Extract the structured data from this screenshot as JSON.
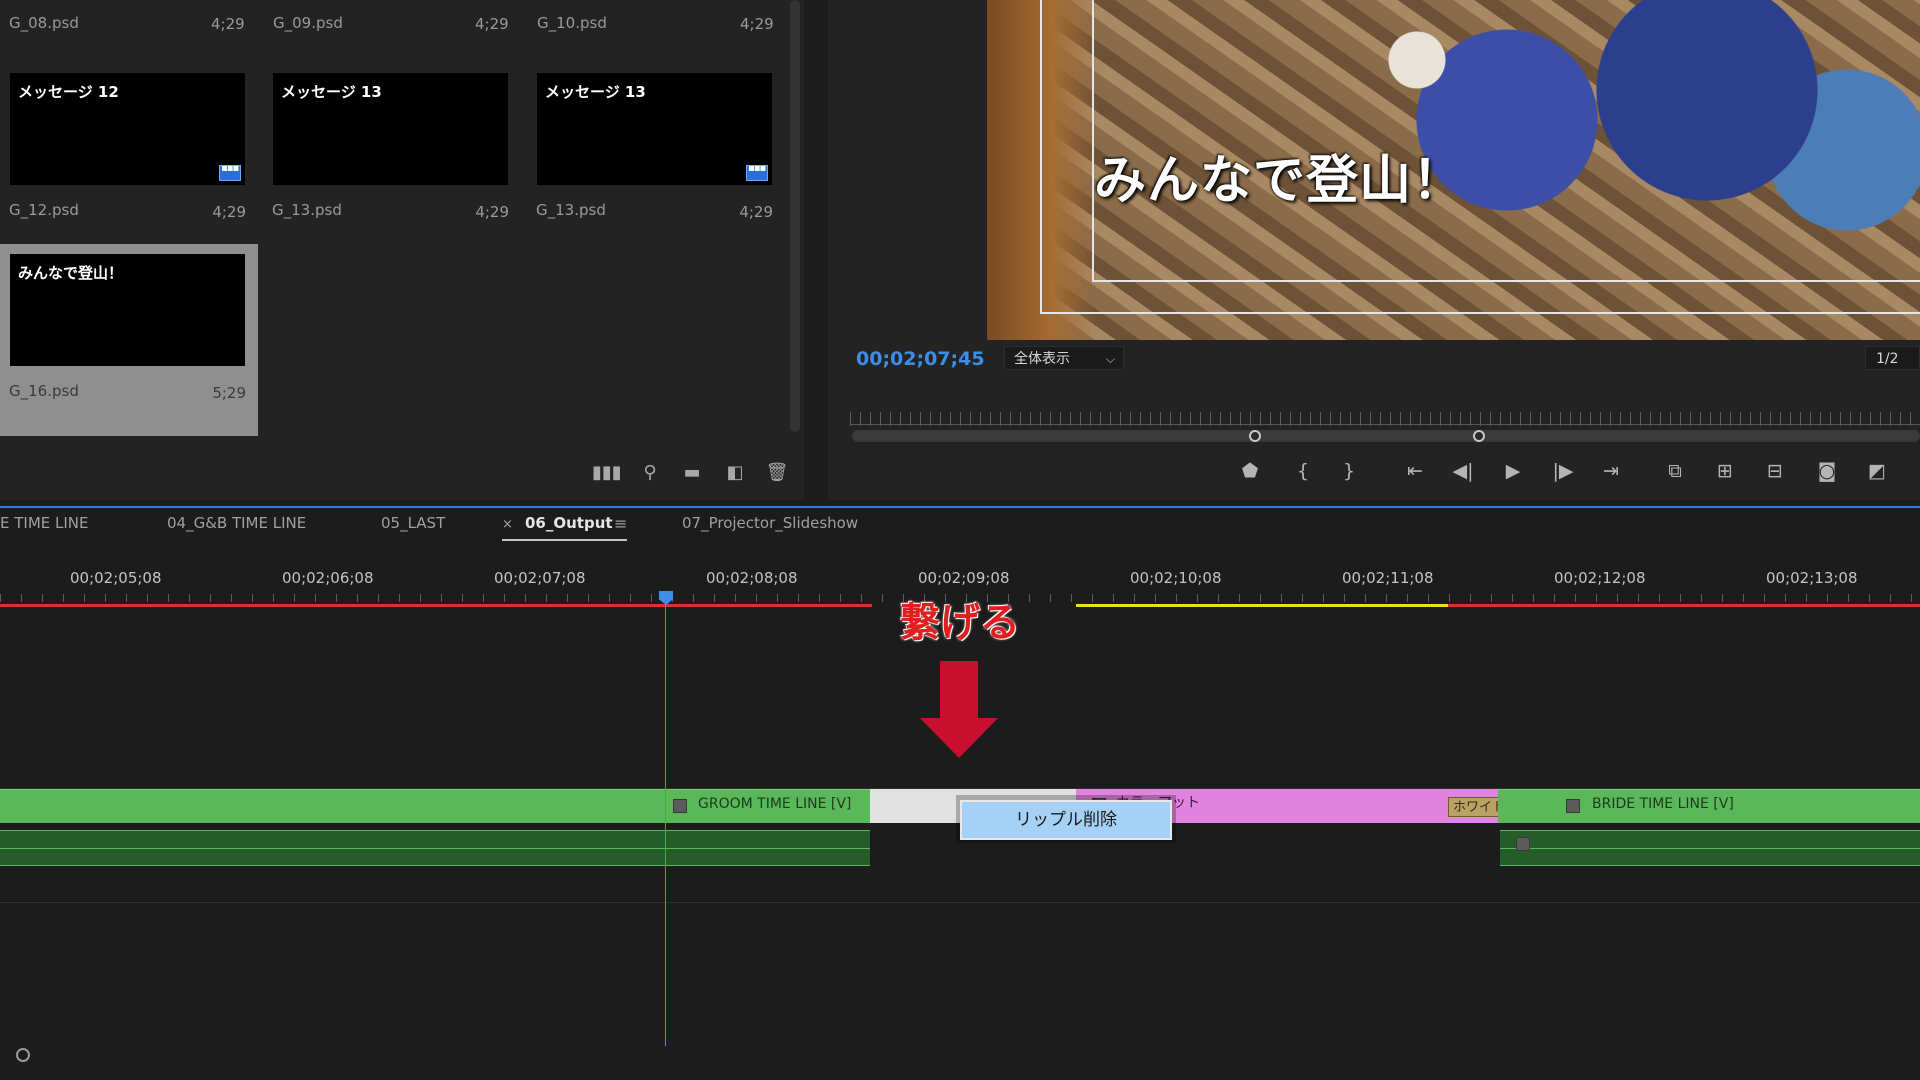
{
  "bin": {
    "top_row": [
      {
        "name": "G_08.psd",
        "duration": "4;29"
      },
      {
        "name": "G_09.psd",
        "duration": "4;29"
      },
      {
        "name": "G_10.psd",
        "duration": "4;29"
      }
    ],
    "items": [
      {
        "title": "メッセージ 12",
        "name": "G_12.psd",
        "duration": "4;29"
      },
      {
        "title": "メッセージ 13",
        "name": "G_13.psd",
        "duration": "4;29"
      },
      {
        "title": "メッセージ 13",
        "name": "G_13.psd",
        "duration": "4;29"
      },
      {
        "title": "みんなで登山！",
        "name": "G_16.psd",
        "duration": "5;29"
      }
    ],
    "tools": [
      "list-view-icon",
      "search-icon",
      "folder-icon",
      "new-item-icon",
      "trash-icon"
    ]
  },
  "monitor": {
    "video_title": "みんなで登山！",
    "timecode": "00;02;07;45",
    "zoom": "全体表示",
    "resolution": "1/2",
    "transport": [
      "marker-icon",
      "mark-in-icon",
      "mark-out-icon",
      "go-to-in-icon",
      "step-back-icon",
      "play-icon",
      "step-forward-icon",
      "go-to-out-icon",
      "lift-icon",
      "insert-icon",
      "overwrite-icon",
      "camera-icon",
      "compare-icon"
    ]
  },
  "timeline": {
    "tabs": [
      "E TIME LINE",
      "04_G&B TIME LINE",
      "05_LAST",
      "06_Output",
      "07_Projector_Slideshow"
    ],
    "active_tab_close": "×",
    "timecodes": [
      "00;02;05;08",
      "00;02;06;08",
      "00;02;07;08",
      "00;02;08;08",
      "00;02;09;08",
      "00;02;10;08",
      "00;02;11;08",
      "00;02;12;08",
      "00;02;13;08"
    ],
    "annotation": "繋げる",
    "clips": {
      "groom": "GROOM TIME LINE [V]",
      "pink": "カラーマット",
      "transition": "ホワイトアウト",
      "bride": "BRIDE TIME LINE [V]"
    },
    "context_menu": "リップル削除"
  }
}
